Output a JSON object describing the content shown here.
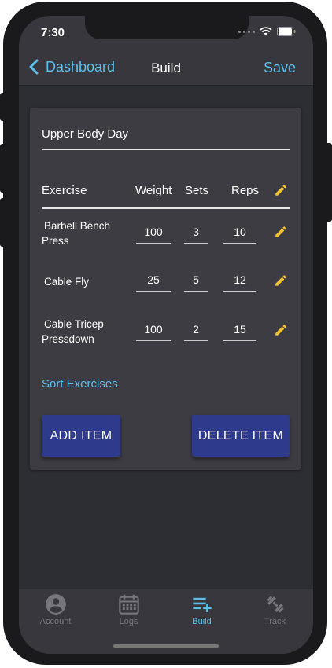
{
  "status": {
    "time": "7:30"
  },
  "nav": {
    "back_label": "Dashboard",
    "title": "Build",
    "save_label": "Save"
  },
  "routine": {
    "name": "Upper Body Day"
  },
  "table": {
    "headers": {
      "exercise": "Exercise",
      "weight": "Weight",
      "sets": "Sets",
      "reps": "Reps"
    },
    "rows": [
      {
        "name_line1": "Barbell Bench",
        "name_line2": "Press",
        "weight": "100",
        "sets": "3",
        "reps": "10"
      },
      {
        "name_line1": "Cable Fly",
        "name_line2": "",
        "weight": "25",
        "sets": "5",
        "reps": "12"
      },
      {
        "name_line1": "Cable Tricep",
        "name_line2": "Pressdown",
        "weight": "100",
        "sets": "2",
        "reps": "15"
      }
    ]
  },
  "actions": {
    "sort_label": "Sort Exercises",
    "add_label": "ADD ITEM",
    "delete_label": "DELETE ITEM"
  },
  "tabs": [
    {
      "label": "Account",
      "icon": "account-icon",
      "active": false
    },
    {
      "label": "Logs",
      "icon": "calendar-icon",
      "active": false
    },
    {
      "label": "Build",
      "icon": "playlist-add-icon",
      "active": true
    },
    {
      "label": "Track",
      "icon": "dumbbell-icon",
      "active": false
    }
  ],
  "colors": {
    "accent": "#5bc0eb",
    "button": "#2e3b8c",
    "edit_icon": "#f2c230",
    "background": "#2d2d34",
    "card": "#3d3c43"
  }
}
